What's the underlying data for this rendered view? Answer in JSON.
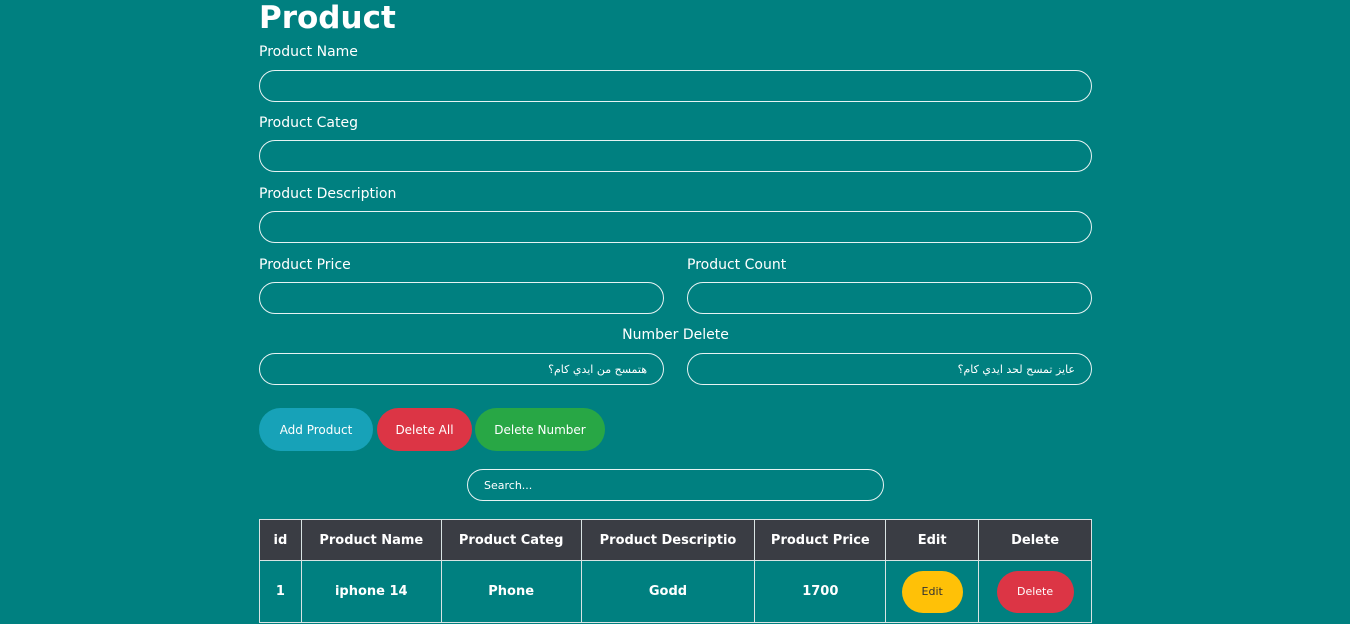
{
  "page": {
    "title": "Product"
  },
  "form": {
    "name_label": "Product Name",
    "categ_label": "Product Categ",
    "desc_label": "Product Description",
    "price_label": "Product Price",
    "count_label": "Product Count",
    "number_delete_label": "Number Delete",
    "delete_from_placeholder": "هتمسح من ايدي كام؟",
    "delete_to_placeholder": "عايز تمسح لحد ايدي كام؟",
    "search_placeholder": "Search..."
  },
  "buttons": {
    "add": "Add Product",
    "delete_all": "Delete All",
    "delete_number": "Delete Number"
  },
  "colors": {
    "background": "#008080",
    "add": "#17a2b8",
    "delete": "#dc3545",
    "delete_number": "#28a745",
    "edit": "#ffc107",
    "table_header": "#3a3d44"
  },
  "table": {
    "headers": [
      "id",
      "Product Name",
      "Product Categ",
      "Product Descriptio",
      "Product Price",
      "Edit",
      "Delete"
    ],
    "rows": [
      {
        "id": "1",
        "name": "iphone 14",
        "categ": "Phone",
        "desc": "Godd",
        "price": "1700",
        "edit": "Edit",
        "delete": "Delete"
      }
    ]
  }
}
